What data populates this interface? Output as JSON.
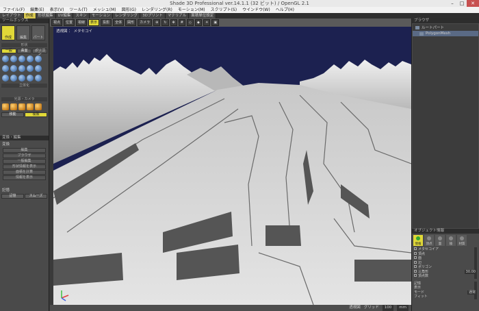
{
  "window": {
    "title": "Shade 3D Professional ver.14.1.1 (32 ビット) / OpenGL 2.1"
  },
  "menu": [
    "ファイル(F)",
    "編集(E)",
    "表示(V)",
    "ツール(T)",
    "メッシュ(M)",
    "図形(G)",
    "レンダリング(R)",
    "モーション(M)",
    "スクリプト(S)",
    "ウインドウ(W)",
    "ヘルプ(H)"
  ],
  "tabs": [
    "レイアウト",
    "作成",
    "形状編集",
    "UV編集",
    "スキン",
    "モーション",
    "レンダリング",
    "3Dプリント",
    "マテリアル",
    "面積単位設定"
  ],
  "active_tab_index": 1,
  "left": {
    "panel_title": "ツールボックス",
    "big_tools": [
      "作成",
      "編集",
      "パート"
    ],
    "create_section": "形状",
    "create_tabs": [
      "一般",
      "曲面",
      "ポリゴン"
    ],
    "solid_label": "立体化",
    "light_section": "光源・カメラ",
    "move_buttons": [
      "移動",
      "複製"
    ],
    "transform_title": "変換・編集",
    "transform_items": [
      "変換",
      "編集",
      "ブラウザ",
      "一般編集",
      "形状情報を表示",
      "面積を計算",
      "情報を表示"
    ],
    "lower_title": "記憶",
    "lower_items": [
      "記憶",
      "スムーズ"
    ]
  },
  "viewport": {
    "label": "透視図  ：  メタセコイ",
    "toolbar": [
      "視点",
      "位置",
      "視線",
      "表示",
      "投影",
      "全体",
      "図形",
      "カメラ"
    ],
    "status": [
      "透視図",
      "グリッド",
      "100",
      "mm"
    ]
  },
  "right": {
    "panel_title": "ブラウザ",
    "tree": [
      "ルートパート",
      "PolygonMesh"
    ],
    "attr_title": "オブジェクト情報",
    "attr_tabs": [
      "情報",
      "頂点",
      "面",
      "稜",
      "材質"
    ],
    "props": [
      {
        "label": "メタセコイア",
        "value": ""
      },
      {
        "label": "頂点",
        "value": ""
      },
      {
        "label": "面",
        "value": ""
      },
      {
        "label": "辺",
        "value": ""
      },
      {
        "label": "ポリゴン",
        "value": ""
      },
      {
        "label": "三角形",
        "value": "30.00"
      },
      {
        "label": "頂点数",
        "value": ""
      }
    ],
    "footer": [
      {
        "label": "記憶",
        "value": ""
      },
      {
        "label": "表示",
        "value": ""
      },
      {
        "label": "モード",
        "value": "通常"
      },
      {
        "label": "フィット",
        "value": ""
      }
    ]
  },
  "colors": {
    "accent": "#e0d838",
    "sky": "#1c2150",
    "terrain": "#d4d4d4"
  }
}
